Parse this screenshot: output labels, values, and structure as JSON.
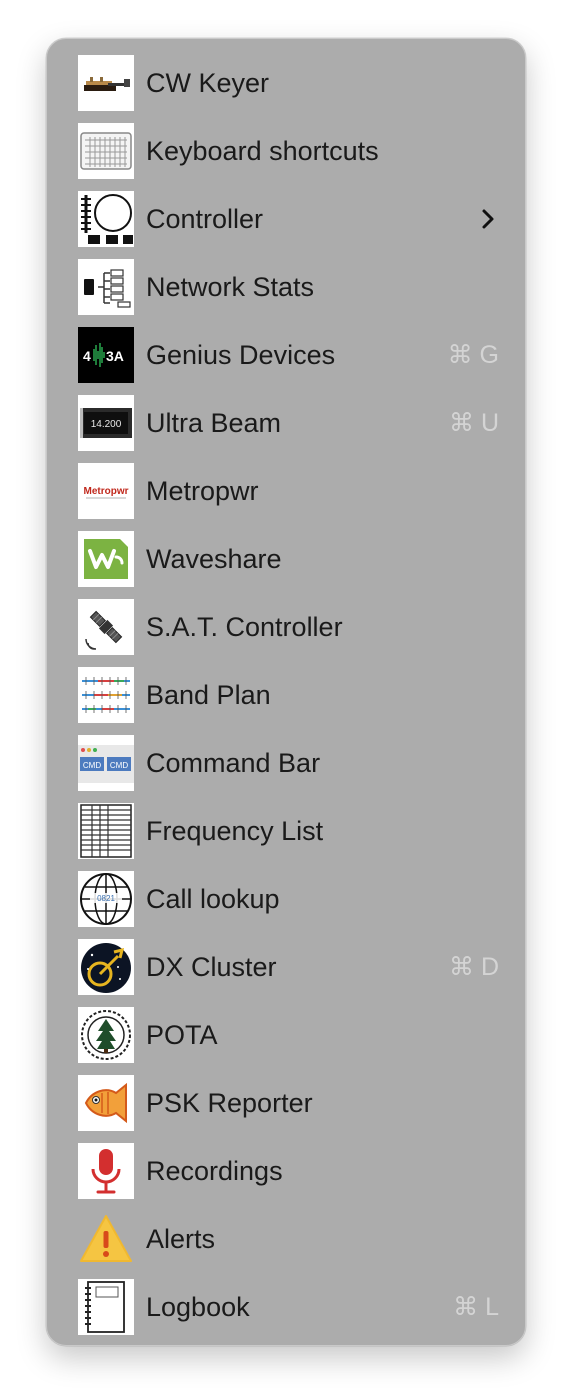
{
  "menu": {
    "items": [
      {
        "label": "CW Keyer",
        "icon": "cw-keyer-icon",
        "shortcut": ""
      },
      {
        "label": "Keyboard shortcuts",
        "icon": "keyboard-icon",
        "shortcut": ""
      },
      {
        "label": "Controller",
        "icon": "controller-icon",
        "shortcut": "",
        "submenu": true
      },
      {
        "label": "Network Stats",
        "icon": "network-stats-icon",
        "shortcut": ""
      },
      {
        "label": "Genius Devices",
        "icon": "genius-devices-icon",
        "shortcut": "⌘ G",
        "icon_text": "4 3A"
      },
      {
        "label": "Ultra Beam",
        "icon": "ultra-beam-icon",
        "shortcut": "⌘ U",
        "icon_text": "14.200"
      },
      {
        "label": "Metropwr",
        "icon": "metropwr-icon",
        "shortcut": "",
        "icon_text": "Metropwr"
      },
      {
        "label": "Waveshare",
        "icon": "waveshare-icon",
        "shortcut": ""
      },
      {
        "label": "S.A.T. Controller",
        "icon": "satellite-icon",
        "shortcut": ""
      },
      {
        "label": "Band Plan",
        "icon": "band-plan-icon",
        "shortcut": ""
      },
      {
        "label": "Command Bar",
        "icon": "command-bar-icon",
        "shortcut": "",
        "icon_text": "CMD"
      },
      {
        "label": "Frequency List",
        "icon": "frequency-list-icon",
        "shortcut": ""
      },
      {
        "label": "Call lookup",
        "icon": "globe-icon",
        "shortcut": ""
      },
      {
        "label": "DX Cluster",
        "icon": "dx-cluster-icon",
        "shortcut": "⌘ D"
      },
      {
        "label": "POTA",
        "icon": "pota-icon",
        "shortcut": ""
      },
      {
        "label": "PSK Reporter",
        "icon": "fish-icon",
        "shortcut": ""
      },
      {
        "label": "Recordings",
        "icon": "microphone-icon",
        "shortcut": ""
      },
      {
        "label": "Alerts",
        "icon": "warning-icon",
        "shortcut": ""
      },
      {
        "label": "Logbook",
        "icon": "notebook-icon",
        "shortcut": "⌘ L"
      }
    ]
  },
  "colors": {
    "menu_background": "#acacac",
    "label": "#1a1a1a",
    "shortcut": "#d4d4d4",
    "waveshare_green": "#7cb342",
    "recordings_red": "#d32f2f",
    "alert_yellow": "#f5c542"
  }
}
